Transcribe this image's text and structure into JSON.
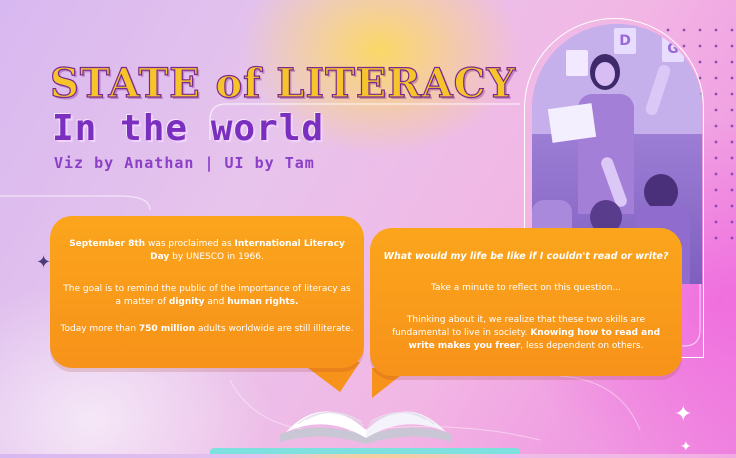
{
  "header": {
    "title_line1": "STATE of LITERACY",
    "title_line2": "In the world",
    "credits": "Viz by Anathan | UI by Tam"
  },
  "photo": {
    "letter_cards": [
      "D",
      "G"
    ]
  },
  "bubble_left": {
    "p1_strong1": "September 8th",
    "p1_text1": " was proclaimed as ",
    "p1_strong2": "International Literacy Day",
    "p1_text2": " by UNESCO in 1966.",
    "p2_text1": "The goal  is to remind the public of the importance of literacy as a matter of ",
    "p2_strong1": "dignity",
    "p2_text2": " and ",
    "p2_strong2": "human rights.",
    "p3_text1": "Today more than ",
    "p3_strong": "750 million",
    "p3_text2": " adults worldwide are still illiterate."
  },
  "bubble_right": {
    "question": "What would my life be like if I couldn't read or write?",
    "p2": "Take a minute to reflect on this question...",
    "p3_text1": "Thinking about it, we realize that these two skills are fundamental to live in society. ",
    "p3_strong": "Knowing how to read and write makes you freer",
    "p3_text2": ", less dependent on others."
  },
  "colors": {
    "bubble": "#f7921a",
    "title_gold": "#f6c52b",
    "title_purple": "#7b2fbe",
    "accent_cyan": "#7fe0e0"
  }
}
